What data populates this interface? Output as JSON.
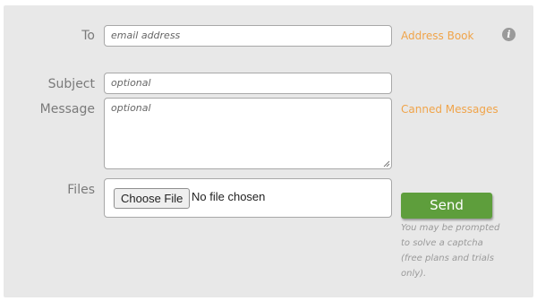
{
  "form": {
    "to_label": "To",
    "to_placeholder": "email address",
    "address_book_link": "Address Book",
    "info_icon": "info-icon",
    "subject_label": "Subject",
    "subject_placeholder": "optional",
    "message_label": "Message",
    "message_placeholder": "optional",
    "canned_messages_link": "Canned Messages",
    "files_label": "Files",
    "choose_file_label": "Choose File",
    "no_file_text": "No file chosen",
    "send_label": "Send",
    "captcha_note": "You may be prompted to solve a captcha (free plans and trials only)."
  },
  "colors": {
    "panel_bg": "#e8e8e8",
    "link": "#f0a44a",
    "send_button": "#5e9e3c",
    "label": "#7a7a7a"
  }
}
